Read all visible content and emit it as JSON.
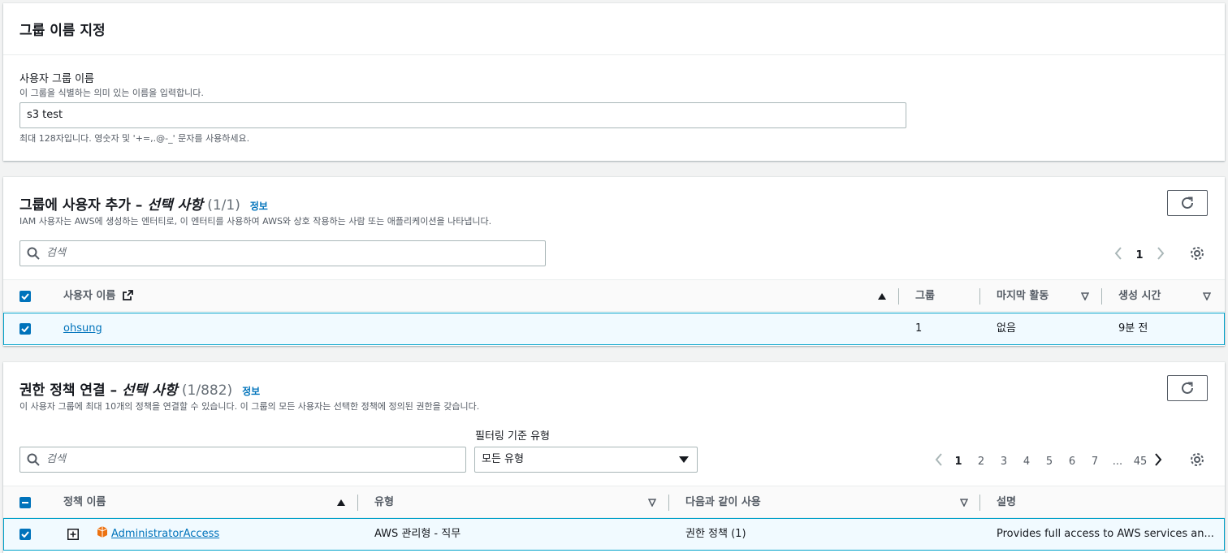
{
  "name_section": {
    "title": "그룹 이름 지정",
    "field_label": "사용자 그룹 이름",
    "field_desc": "이 그룹을 식별하는 의미 있는 이름을 입력합니다.",
    "field_value": "s3 test",
    "constraint": "최대 128자입니다. 영숫자 및 '+=,.@-_' 문자를 사용하세요."
  },
  "users_section": {
    "title": "그룹에 사용자 추가",
    "dash": " – ",
    "optional": "선택 사항",
    "count": " (1/1)",
    "info": "정보",
    "description": "IAM 사용자는 AWS에 생성하는 엔터티로, 이 엔터티를 사용하여 AWS와 상호 작용하는 사람 또는 애플리케이션을 나타냅니다.",
    "search_placeholder": "검색",
    "page": "1",
    "columns": {
      "name": "사용자 이름",
      "groups": "그룹",
      "last_activity": "마지막 활동",
      "created": "생성 시간"
    },
    "rows": [
      {
        "name": "ohsung",
        "groups": "1",
        "last_activity": "없음",
        "created": "9분 전"
      }
    ]
  },
  "policies_section": {
    "title": "권한 정책 연결",
    "dash": " – ",
    "optional": "선택 사항",
    "count": " (1/882)",
    "info": "정보",
    "description": "이 사용자 그룹에 최대 10개의 정책을 연결할 수 있습니다. 이 그룹의 모든 사용자는 선택한 정책에 정의된 권한을 갖습니다.",
    "search_placeholder": "검색",
    "filter_label": "필터링 기준 유형",
    "filter_value": "모든 유형",
    "pages": [
      "1",
      "2",
      "3",
      "4",
      "5",
      "6",
      "7",
      "...",
      "45"
    ],
    "columns": {
      "name": "정책 이름",
      "type": "유형",
      "used_as": "다음과 같이 사용",
      "description": "설명"
    },
    "rows": [
      {
        "name": "AdministratorAccess",
        "type": "AWS 관리형 - 직무",
        "used_as": "권한 정책 (1)",
        "description": "Provides full access to AWS services an..."
      }
    ]
  },
  "colors": {
    "accent": "#0073bb",
    "selected_row_bg": "#f1faff",
    "selected_row_border": "#00a1c9",
    "policy_icon": "#ec7211"
  }
}
